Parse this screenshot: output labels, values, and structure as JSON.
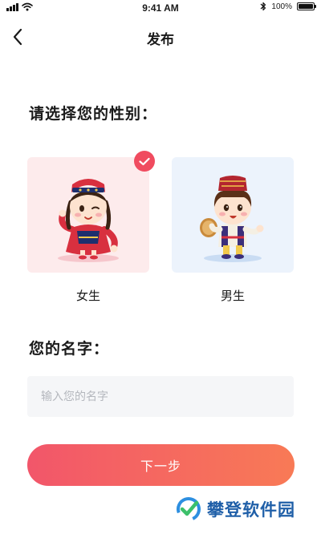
{
  "status_bar": {
    "time": "9:41 AM",
    "battery": "100%"
  },
  "nav": {
    "title": "发布"
  },
  "gender_section": {
    "title": "请选择您的性别：",
    "options": [
      {
        "label": "女生",
        "selected": true,
        "icon": "female-uyghur-character"
      },
      {
        "label": "男生",
        "selected": false,
        "icon": "male-uyghur-character"
      }
    ]
  },
  "name_section": {
    "title": "您的名字：",
    "input_value": "",
    "placeholder": "输入您的名字"
  },
  "actions": {
    "next_label": "下一步"
  },
  "watermark": {
    "text": "攀登软件园"
  },
  "colors": {
    "accent": "#f04b5f",
    "button_gradient_start": "#f2566a",
    "button_gradient_end": "#f87a56",
    "female_card_bg": "#fdebec",
    "male_card_bg": "#ecf3fc",
    "input_bg": "#f5f6f8",
    "watermark_blue": "#1f5fa8"
  }
}
